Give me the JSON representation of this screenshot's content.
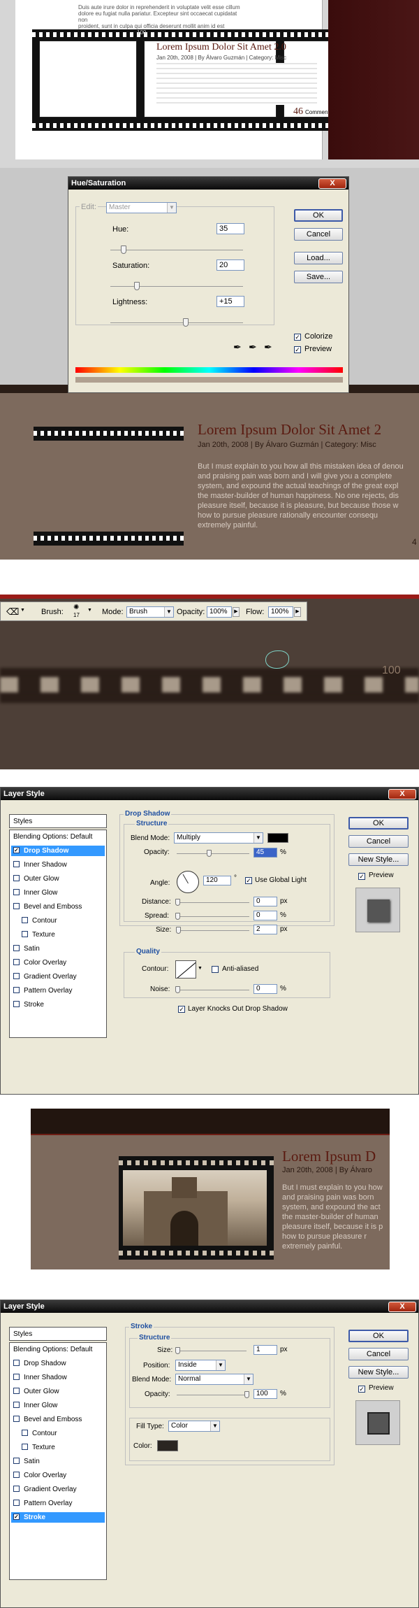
{
  "panel1": {
    "lorem_lines": [
      "Duis aute irure dolor in reprehenderit in voluptate velit esse cillum",
      "dolore eu fugiat nulla pariatur. Excepteur sint occaecat cupidatat non",
      "proident, sunt in culpa qui officia deserunt mollit anim id est laborum."
    ],
    "film_number": "100",
    "post_title": "Lorem Ipsum Dolor Sit Amet 2.0",
    "post_meta": "Jan 20th, 2008 | By Álvaro Guzmán | Category: Misc",
    "comments_count": "46",
    "comments_label": "Comments"
  },
  "hue_dialog": {
    "title": "Hue/Saturation",
    "close": "X",
    "edit_label": "Edit:",
    "edit_value": "Master",
    "hue_label": "Hue:",
    "hue_value": "35",
    "saturation_label": "Saturation:",
    "saturation_value": "20",
    "lightness_label": "Lightness:",
    "lightness_value": "+15",
    "ok": "OK",
    "cancel": "Cancel",
    "load": "Load...",
    "save": "Save...",
    "colorize": "Colorize",
    "preview": "Preview",
    "hue_level": 0.1,
    "sat_level": 0.2,
    "light_level": 0.57
  },
  "panel2": {
    "post_title": "Lorem Ipsum Dolor Sit Amet 2",
    "post_meta": "Jan 20th, 2008 | By Álvaro Guzmán | Category: Misc",
    "body": [
      "But I must explain to you how all this mistaken idea of denou",
      "and praising pain was born and I will give you a complete",
      "system, and expound the actual teachings of the great expl",
      "the master-builder of human happiness. No one rejects, dis",
      "pleasure itself, because it is pleasure, but because those w",
      "how to pursue pleasure rationally encounter consequ",
      "extremely painful."
    ],
    "corner_number": "4"
  },
  "toolbar": {
    "brush_label": "Brush:",
    "brush_size": "17",
    "mode_label": "Mode:",
    "mode_value": "Brush",
    "opacity_label": "Opacity:",
    "opacity_value": "100%",
    "flow_label": "Flow:",
    "flow_value": "100%",
    "film_number": "100"
  },
  "layer_style_1": {
    "title": "Layer Style",
    "styles_header": "Styles",
    "blending": "Blending Options: Default",
    "items": [
      "Drop Shadow",
      "Inner Shadow",
      "Outer Glow",
      "Inner Glow",
      "Bevel and Emboss",
      "Contour",
      "Texture",
      "Satin",
      "Color Overlay",
      "Gradient Overlay",
      "Pattern Overlay",
      "Stroke"
    ],
    "section": "Drop Shadow",
    "structure": "Structure",
    "blend_mode_label": "Blend Mode:",
    "blend_mode_value": "Multiply",
    "opacity_label": "Opacity:",
    "opacity_value": "45",
    "angle_label": "Angle:",
    "angle_value": "120",
    "global_light": "Use Global Light",
    "distance_label": "Distance:",
    "distance_value": "0",
    "spread_label": "Spread:",
    "spread_value": "0",
    "size_label": "Size:",
    "size_value": "2",
    "px": "px",
    "pct": "%",
    "deg": "°",
    "quality": "Quality",
    "contour_label": "Contour:",
    "anti_aliased": "Anti-aliased",
    "noise_label": "Noise:",
    "noise_value": "0",
    "knocks_out": "Layer Knocks Out Drop Shadow",
    "ok": "OK",
    "cancel": "Cancel",
    "new_style": "New Style...",
    "preview": "Preview",
    "opacity_level": 0.45
  },
  "panel3": {
    "post_title": "Lorem Ipsum D",
    "post_meta": "Jan 20th, 2008 | By Álvaro",
    "body": [
      "But I must explain to you how",
      "and praising pain was born",
      "system, and expound the act",
      "the master-builder of human",
      "pleasure itself, because it is p",
      "how to pursue pleasure r",
      "extremely painful."
    ]
  },
  "layer_style_2": {
    "title": "Layer Style",
    "styles_header": "Styles",
    "blending": "Blending Options: Default",
    "items": [
      "Drop Shadow",
      "Inner Shadow",
      "Outer Glow",
      "Inner Glow",
      "Bevel and Emboss",
      "Contour",
      "Texture",
      "Satin",
      "Color Overlay",
      "Gradient Overlay",
      "Pattern Overlay",
      "Stroke"
    ],
    "section": "Stroke",
    "structure": "Structure",
    "size_label": "Size:",
    "size_value": "1",
    "px": "px",
    "position_label": "Position:",
    "position_value": "Inside",
    "blend_mode_label": "Blend Mode:",
    "blend_mode_value": "Normal",
    "opacity_label": "Opacity:",
    "opacity_value": "100",
    "pct": "%",
    "fill_type_label": "Fill Type:",
    "fill_type_value": "Color",
    "color_label": "Color:",
    "stroke_color": "#2a2521",
    "ok": "OK",
    "cancel": "Cancel",
    "new_style": "New Style...",
    "preview": "Preview"
  },
  "colors": {
    "brown_bg": "#7d6a5d",
    "title_red": "#5a1a10",
    "selection_blue": "#3399ff",
    "dialog_bg": "#ece9d8"
  }
}
